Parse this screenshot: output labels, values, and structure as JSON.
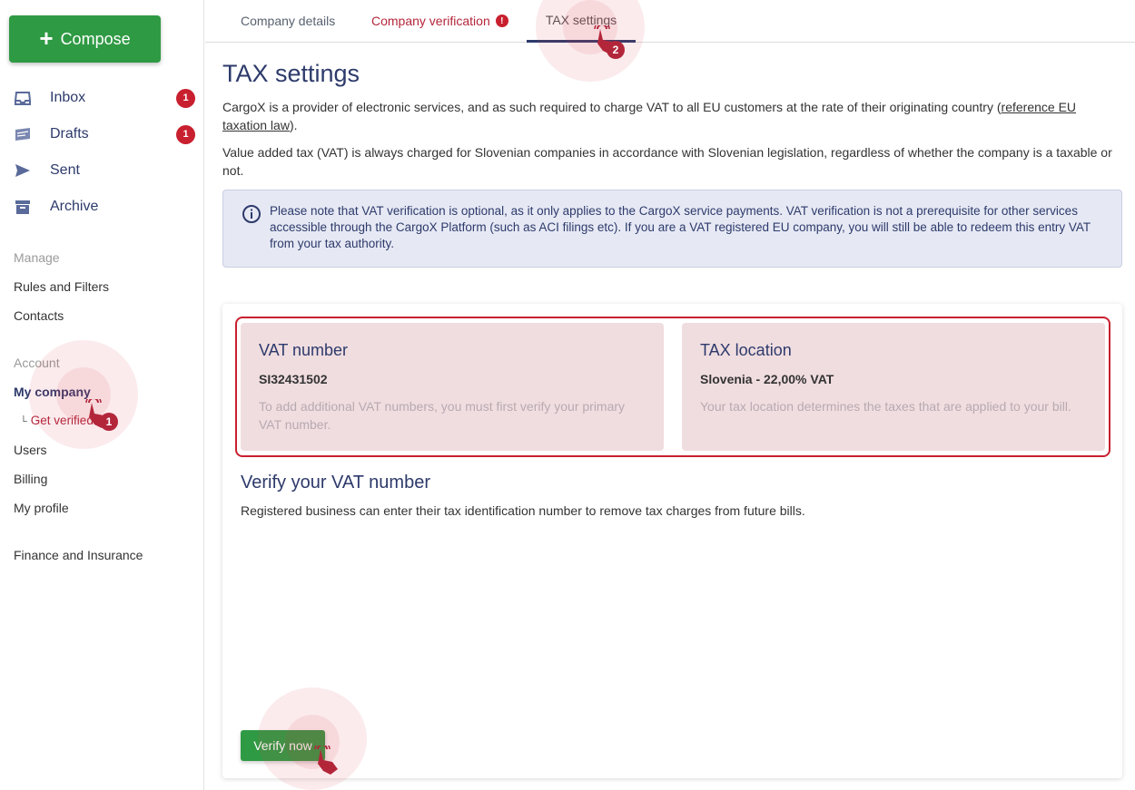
{
  "sidebar": {
    "compose_label": "Compose",
    "mail": [
      {
        "label": "Inbox",
        "badge": "1",
        "icon": "inbox-icon"
      },
      {
        "label": "Drafts",
        "badge": "1",
        "icon": "drafts-icon"
      },
      {
        "label": "Sent",
        "icon": "sent-icon"
      },
      {
        "label": "Archive",
        "icon": "archive-icon"
      }
    ],
    "manage_label": "Manage",
    "manage_links": [
      "Rules and Filters",
      "Contacts"
    ],
    "account_label": "Account",
    "account_active": "My company",
    "account_sub": "Get verified",
    "account_links": [
      "Users",
      "Billing",
      "My profile"
    ],
    "finance_label": "Finance and Insurance"
  },
  "tabs": {
    "company_details": "Company details",
    "company_verification": "Company verification",
    "tax_settings": "TAX settings"
  },
  "main": {
    "title": "TAX settings",
    "para1_text": "CargoX is a provider of electronic services, and as such required to charge VAT to all EU customers at the rate of their originating country (",
    "para1_link": "reference EU taxation law",
    "para1_end": ").",
    "para2": "Value added tax (VAT) is always charged for Slovenian companies in accordance with Slovenian legislation, regardless of whether the company is a taxable or not.",
    "info": "Please note that VAT verification is optional, as it only applies to the CargoX service payments. VAT verification is not a prerequisite for other services accessible through the CargoX Platform (such as ACI filings etc). If you are a VAT registered EU company, you will still be able to redeem this entry VAT from your tax authority.",
    "vat_heading": "VAT number",
    "vat_value": "SI32431502",
    "vat_desc": "To add additional VAT numbers, you must first verify your primary VAT number.",
    "tax_heading": "TAX location",
    "tax_value": "Slovenia - 22,00% VAT",
    "tax_desc": "Your tax location determines the taxes that are applied to your bill.",
    "verify_title": "Verify your VAT number",
    "verify_desc": "Registered business can enter their tax identification number to remove tax charges from future bills.",
    "verify_button": "Verify now"
  },
  "hints": {
    "step1": "1",
    "step2": "2"
  },
  "colors": {
    "accent": "#2d3a6b",
    "primary_green": "#2f9a44",
    "alert_red": "#c8202f"
  }
}
